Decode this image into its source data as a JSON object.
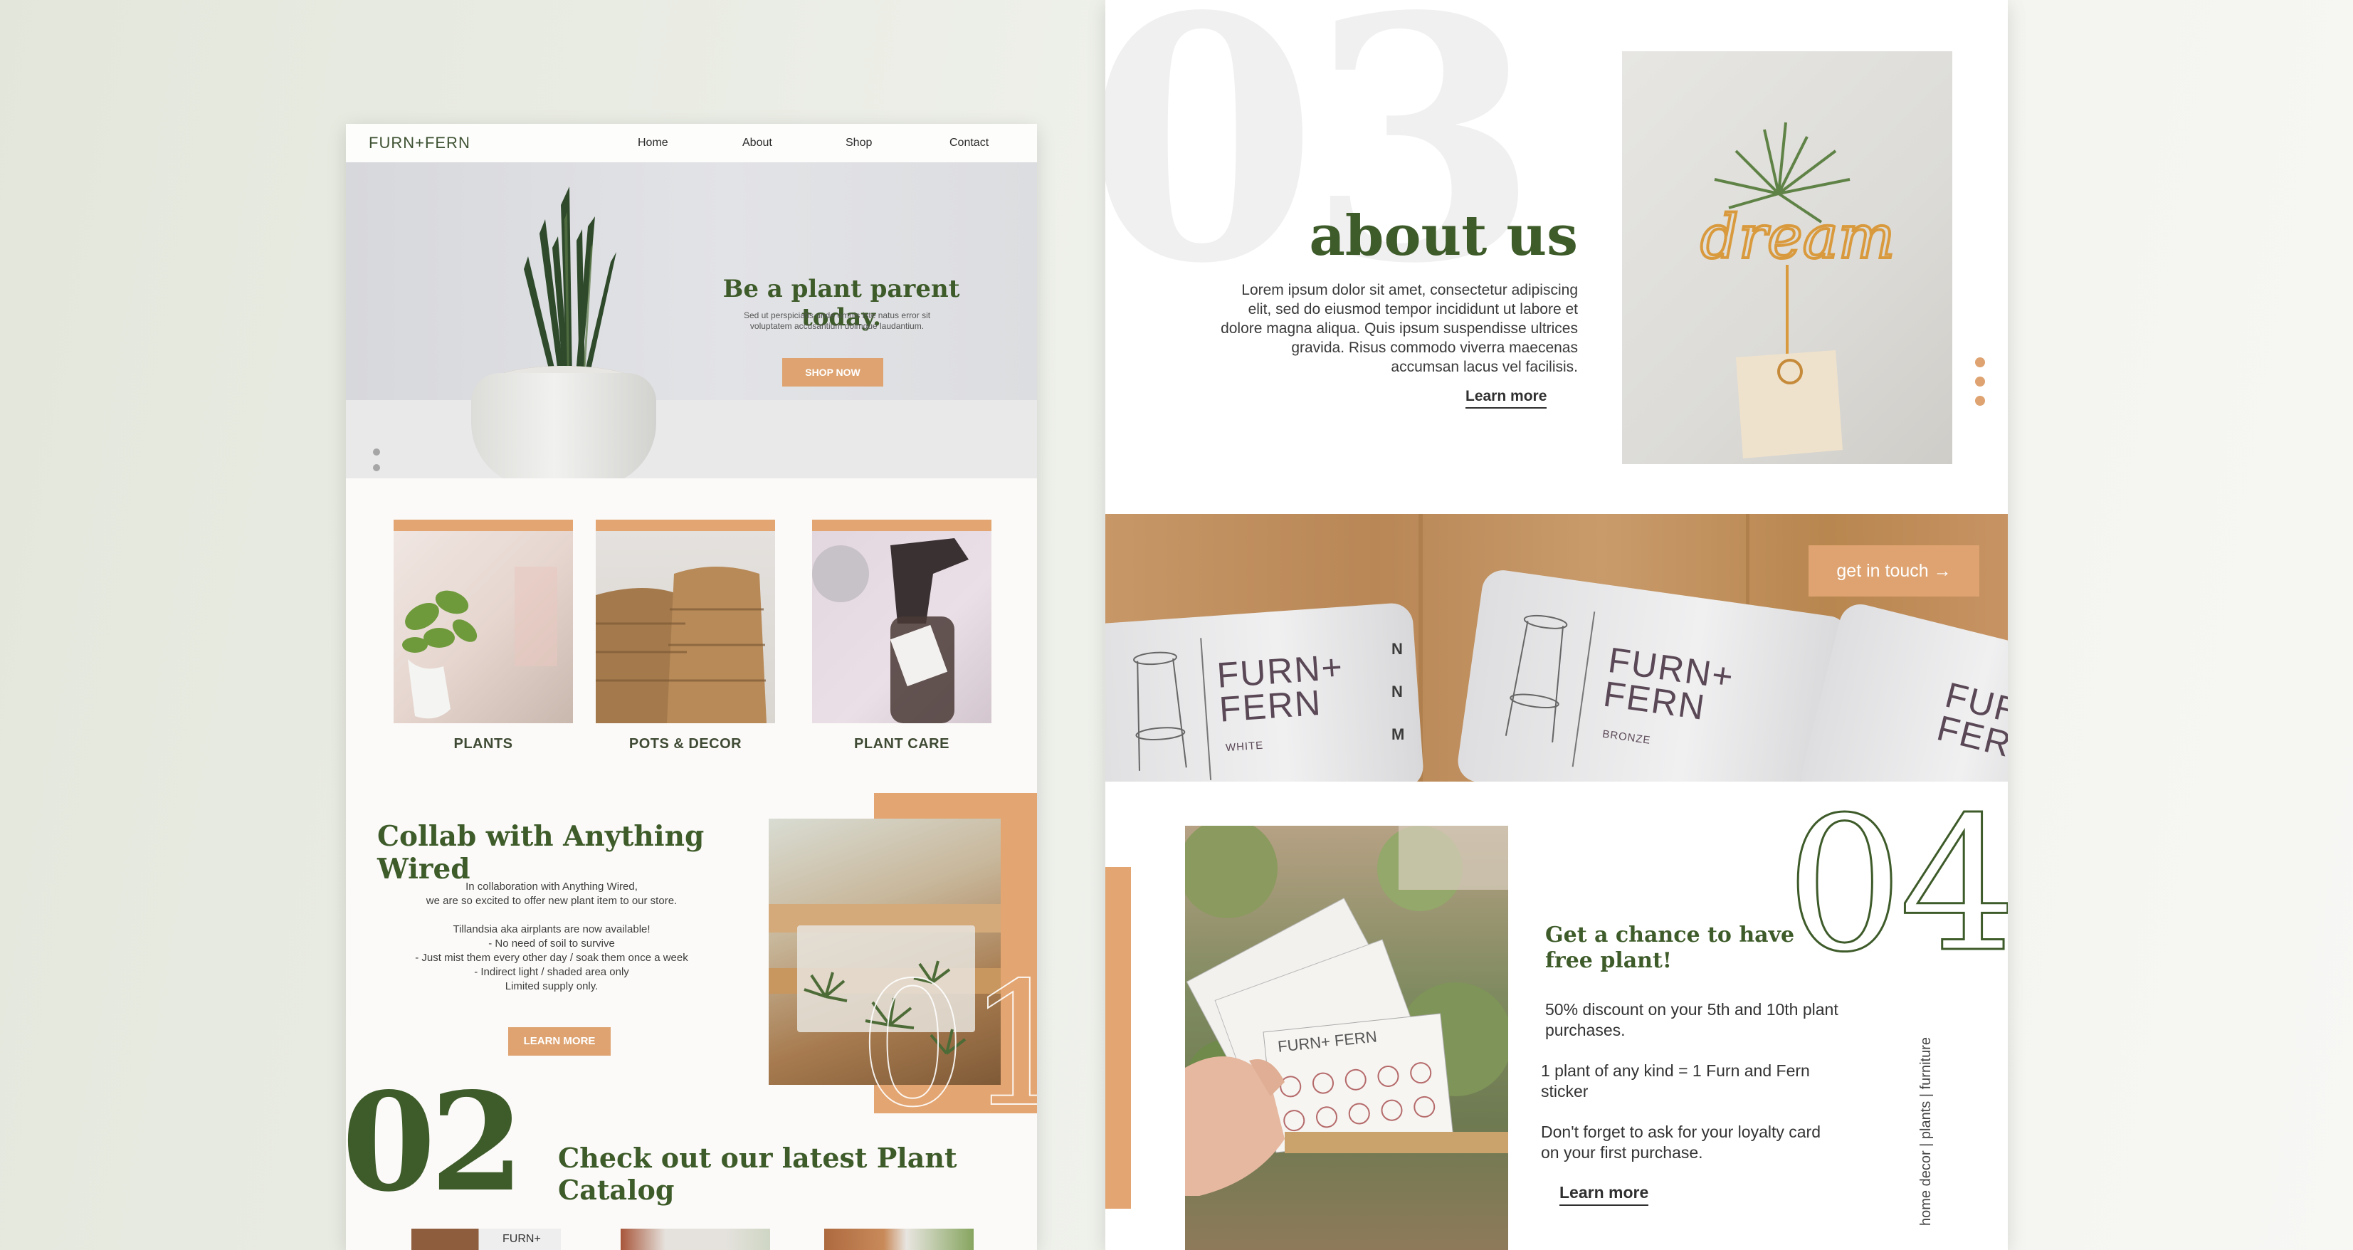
{
  "left_page": {
    "logo": "FURN+FERN",
    "nav": [
      "Home",
      "About",
      "Shop",
      "Contact"
    ],
    "hero": {
      "title": "Be a plant parent today.",
      "subtitle": "Sed ut perspiciatis unde omnis iste natus error sit voluptatem accusantium dolmque laudantium.",
      "button": "SHOP NOW"
    },
    "categories": [
      "PLANTS",
      "POTS & DECOR",
      "PLANT CARE"
    ],
    "collab": {
      "title": "Collab with Anything Wired",
      "body": "In collaboration with Anything Wired,\nwe are so excited to offer new plant item to our store.\n\nTillandsia aka airplants are now available!\n- No need of soil to survive\n- Just mist them every other day / soak them once a week\n- Indirect light / shaded area only\nLimited supply only.",
      "button": "LEARN MORE",
      "number": "01"
    },
    "catalog": {
      "number": "02",
      "title": "Check out our latest Plant Catalog",
      "card_label": "FURN+"
    }
  },
  "right_page": {
    "about": {
      "number": "03",
      "title": "about us",
      "body": "Lorem ipsum dolor sit amet, consectetur adipiscing elit, sed do eiusmod tempor incididunt ut labore et dolore magna aliqua. Quis ipsum suspendisse ultrices gravida. Risus commodo viverra maecenas accumsan lacus vel facilisis.",
      "link": "Learn more",
      "photo_word": "dream"
    },
    "banner": {
      "button": "get in touch →",
      "ticket1": {
        "brand": "FURN+\nFERN",
        "variant": "WHITE"
      },
      "ticket2": {
        "brand": "FURN+\nFERN",
        "variant": "BRONZE"
      },
      "ticket3": {
        "brand": "FURN\nFERN"
      },
      "edge_letters": "N\nN\nM"
    },
    "loyalty": {
      "number": "04",
      "title": "Get a chance to have free plant!",
      "p1": "50% discount on your 5th and 10th plant purchases.",
      "p2": "1 plant of any kind = 1 Furn and Fern sticker",
      "p3": "Don't forget to ask for your loyalty card on your first purchase.",
      "link": "Learn more",
      "card_label": "FURN+\nFERN",
      "vertical_tag": "home decor | plants | furniture"
    }
  },
  "colors": {
    "green": "#3e5b2a",
    "orange": "#dea370",
    "background": "#e3e7db"
  }
}
